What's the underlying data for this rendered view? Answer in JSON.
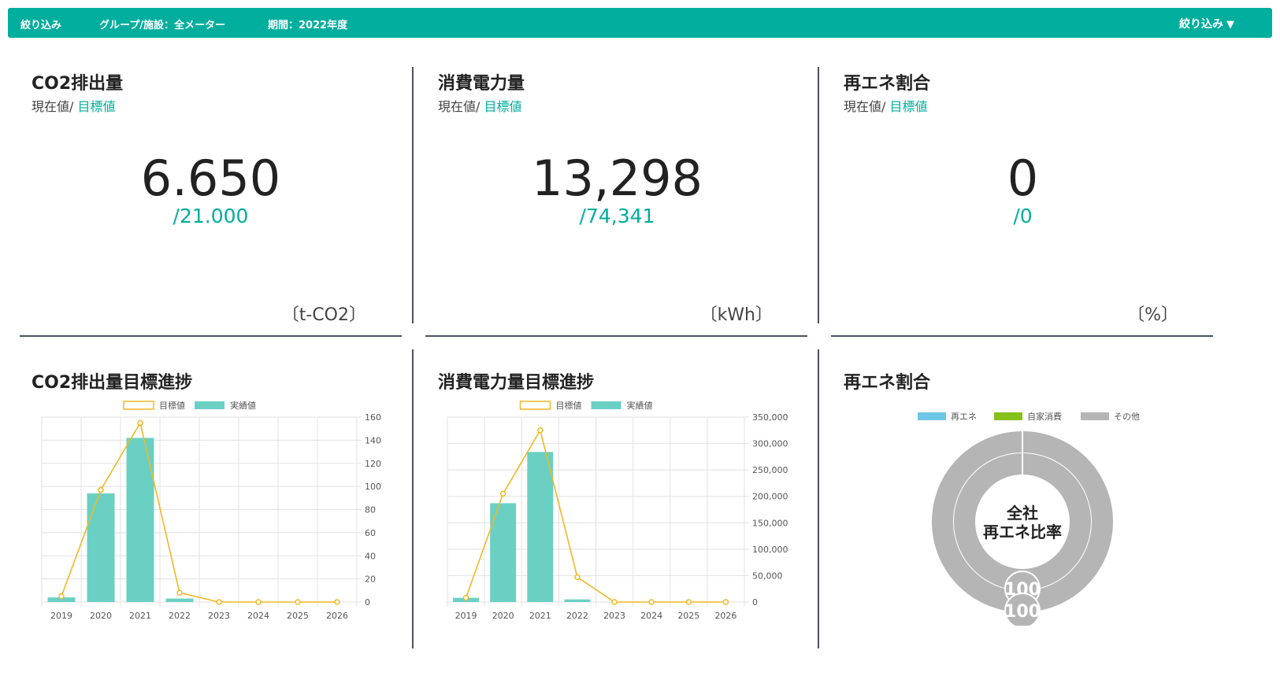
{
  "filter_bar": {
    "label": "絞り込み",
    "group": "グループ/施設：全メーター",
    "period": "期間：2022年度",
    "button_label": "絞り込み",
    "caret": "▼"
  },
  "colors": {
    "accent": "#00ae9d",
    "bar": "#6bd0c4",
    "line": "#f2b824",
    "pie_grey": "#b5b5b5",
    "renew": "#6ec6e6",
    "self": "#86c11a"
  },
  "kpis": [
    {
      "title": "CO2排出量",
      "sub_current": "現在値/ ",
      "sub_target": "目標値",
      "value": "6.650",
      "target": "/21.000",
      "unit": "〔t-CO2〕"
    },
    {
      "title": "消費電力量",
      "sub_current": "現在値/ ",
      "sub_target": "目標値",
      "value": "13,298",
      "target": "/74,341",
      "unit": "〔kWh〕"
    },
    {
      "title": "再エネ割合",
      "sub_current": "現在値/ ",
      "sub_target": "目標値",
      "value": "0",
      "target": "/0",
      "unit": "〔%〕"
    }
  ],
  "charts": {
    "co2_title": "CO2排出量目標進捗",
    "power_title": "消費電力量目標進捗",
    "renew_title": "再エネ割合"
  },
  "chart_data": [
    {
      "type": "bar",
      "title": "CO2排出量目標進捗",
      "categories": [
        "2019",
        "2020",
        "2021",
        "2022",
        "2023",
        "2024",
        "2025",
        "2026"
      ],
      "series": [
        {
          "name": "目標値",
          "kind": "line",
          "values": [
            5,
            97,
            155,
            8,
            0,
            0,
            0,
            0
          ]
        },
        {
          "name": "実績値",
          "kind": "bar",
          "values": [
            4,
            94,
            142,
            3,
            0,
            0,
            0,
            0
          ]
        }
      ],
      "ylim": [
        0,
        160
      ],
      "yticks": [
        "160",
        "140",
        "120",
        "100",
        "80",
        "60",
        "40",
        "20",
        "0"
      ],
      "yaxis": "right",
      "legend": "top-center",
      "grid": true
    },
    {
      "type": "bar",
      "title": "消費電力量目標進捗",
      "categories": [
        "2019",
        "2020",
        "2021",
        "2022",
        "2023",
        "2024",
        "2025",
        "2026"
      ],
      "series": [
        {
          "name": "目標値",
          "kind": "line",
          "values": [
            8000,
            205000,
            325000,
            47000,
            0,
            0,
            0,
            0
          ]
        },
        {
          "name": "実績値",
          "kind": "bar",
          "values": [
            8000,
            187000,
            284000,
            5000,
            0,
            0,
            0,
            0
          ]
        }
      ],
      "ylim": [
        0,
        350000
      ],
      "yticks": [
        "350,000",
        "300,000",
        "250,000",
        "200,000",
        "150,000",
        "100,000",
        "50,000",
        "0"
      ],
      "yaxis": "right",
      "legend": "top-center",
      "grid": true
    },
    {
      "type": "pie",
      "title": "再エネ割合",
      "center_label_1": "全社",
      "center_label_2": "再エネ比率",
      "legend": "top-center",
      "series": [
        {
          "name": "再エネ",
          "value": 0
        },
        {
          "name": "自家消費",
          "value": 0
        },
        {
          "name": "その他",
          "value": 100
        }
      ],
      "rings": [
        {
          "label": "100",
          "values": [
            0,
            0,
            100
          ]
        },
        {
          "label": "100",
          "values": [
            0,
            0,
            100
          ]
        }
      ]
    }
  ]
}
